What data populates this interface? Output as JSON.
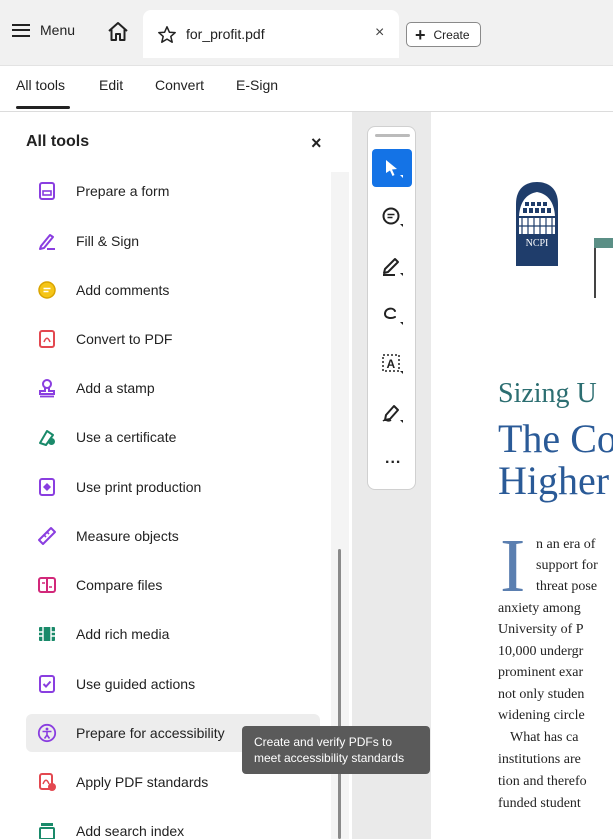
{
  "topbar": {
    "menu_label": "Menu",
    "tab_title": "for_profit.pdf",
    "tab_close": "×",
    "create_label": "Create"
  },
  "menubar": {
    "items": [
      "All tools",
      "Edit",
      "Convert",
      "E-Sign"
    ]
  },
  "panel": {
    "title": "All tools",
    "close": "×",
    "tools": [
      {
        "label": "Prepare a form",
        "icon": "form-icon"
      },
      {
        "label": "Fill & Sign",
        "icon": "pen-sign-icon"
      },
      {
        "label": "Add comments",
        "icon": "comment-icon"
      },
      {
        "label": "Convert to PDF",
        "icon": "pdf-convert-icon"
      },
      {
        "label": "Add a stamp",
        "icon": "stamp-icon"
      },
      {
        "label": "Use a certificate",
        "icon": "certificate-icon"
      },
      {
        "label": "Use print production",
        "icon": "print-production-icon"
      },
      {
        "label": "Measure objects",
        "icon": "ruler-icon"
      },
      {
        "label": "Compare files",
        "icon": "compare-icon"
      },
      {
        "label": "Add rich media",
        "icon": "media-icon"
      },
      {
        "label": "Use guided actions",
        "icon": "guided-actions-icon"
      },
      {
        "label": "Prepare for accessibility",
        "icon": "accessibility-icon"
      },
      {
        "label": "Apply PDF standards",
        "icon": "pdf-standards-icon"
      },
      {
        "label": "Add search index",
        "icon": "search-index-icon"
      }
    ],
    "tooltip_line1": "Create and verify PDFs to",
    "tooltip_line2": "meet accessibility standards"
  },
  "toolbar": {
    "tools": [
      "select-cursor-icon",
      "comment-icon",
      "highlighter-icon",
      "lasso-draw-icon",
      "text-select-icon",
      "sign-icon",
      "more-icon"
    ],
    "more_label": "..."
  },
  "document": {
    "logo_text": "NCPI",
    "subtitle": "Sizing U",
    "title_line1": "The Co",
    "title_line2": "Higher",
    "body_lines": [
      "n an era of",
      "support for",
      "threat pose",
      "anxiety among",
      "University of P",
      "10,000 undergr",
      "prominent exar",
      "not only studen",
      "widening circle",
      "What has ca",
      "institutions are",
      "tion and therefo",
      "funded student"
    ]
  },
  "colors": {
    "accent_blue": "#1473e6",
    "title_blue": "#2a5a97",
    "subtitle_teal": "#2c6e71",
    "logo_navy": "#1f3d6b",
    "tool_purple": "#8a3ee0",
    "tool_red": "#e34850"
  }
}
